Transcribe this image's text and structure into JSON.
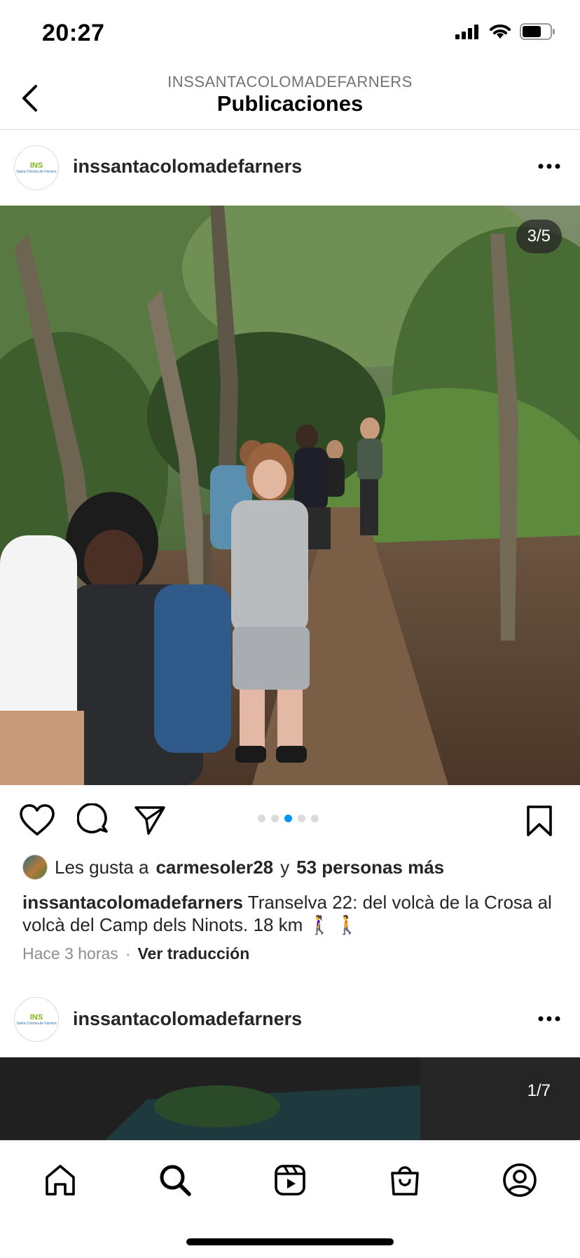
{
  "status_bar": {
    "time": "20:27"
  },
  "header": {
    "subtitle": "INSSANTACOLOMADEFARNERS",
    "title": "Publicaciones"
  },
  "post": {
    "avatar_logo": "INS",
    "avatar_logo_sub": "Santa Coloma de Farners",
    "username": "inssantacolomadefarners",
    "counter": "3/5",
    "carousel": {
      "count": 5,
      "active_index": 2
    },
    "likes": {
      "prefix": "Les gusta a",
      "user": "carmesoler28",
      "connector": "y",
      "others": "53 personas más"
    },
    "caption": {
      "author": "inssantacolomadefarners",
      "text": "Transelva 22: del volcà de la Crosa al volcà del Camp dels Ninots.  18 km 🚶‍♀️ 🚶"
    },
    "time_ago": "Hace 3 horas",
    "separator": "·",
    "translate_label": "Ver traducción"
  },
  "post2": {
    "avatar_logo": "INS",
    "avatar_logo_sub": "Santa Coloma de Farners",
    "username": "inssantacolomadefarners",
    "counter": "1/7"
  },
  "tabbar": {
    "icons": [
      "home-icon",
      "search-icon",
      "reels-icon",
      "shop-icon",
      "profile-icon"
    ]
  },
  "colors": {
    "accent": "#0095f6",
    "text": "#262626",
    "muted": "#8e8e8e"
  }
}
